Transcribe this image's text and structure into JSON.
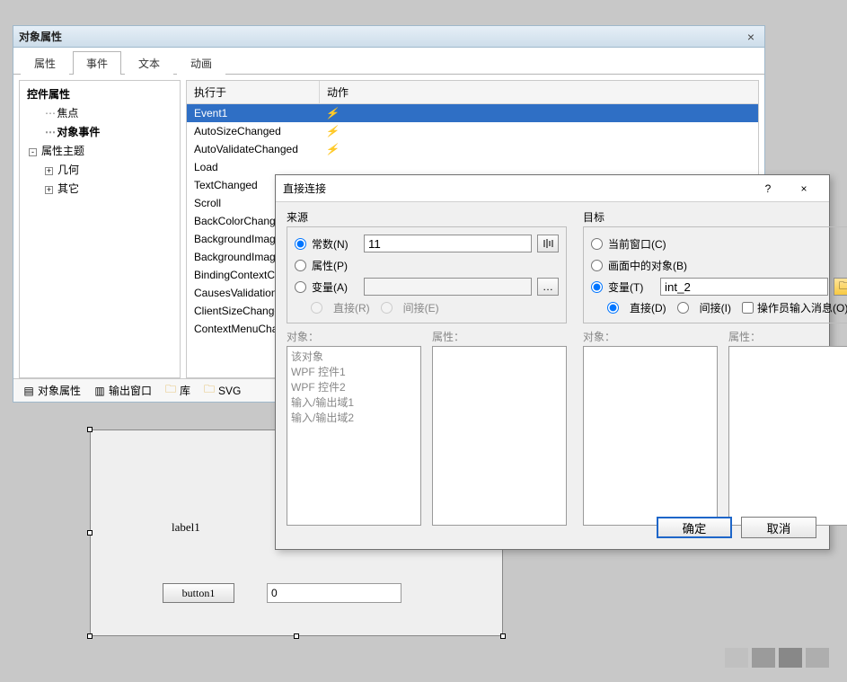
{
  "propWin": {
    "title": "对象属性",
    "tabs": [
      "属性",
      "事件",
      "文本",
      "动画"
    ],
    "activeTab": 1,
    "tree": {
      "header": "控件属性",
      "items": [
        {
          "label": "焦点",
          "indent": 1
        },
        {
          "label": "对象事件",
          "indent": 1,
          "sel": true
        },
        {
          "label": "属性主题",
          "indent": 0,
          "exp": "-"
        },
        {
          "label": "几何",
          "indent": 1,
          "exp": "+"
        },
        {
          "label": "其它",
          "indent": 1,
          "exp": "+"
        }
      ]
    },
    "grid": {
      "col1": "执行于",
      "col2": "动作",
      "rows": [
        {
          "c1": "Event1",
          "sel": true,
          "bolt": true
        },
        {
          "c1": "AutoSizeChanged",
          "bolt": true
        },
        {
          "c1": "AutoValidateChanged",
          "bolt": true
        },
        {
          "c1": "Load"
        },
        {
          "c1": "TextChanged"
        },
        {
          "c1": "Scroll"
        },
        {
          "c1": "BackColorChanged"
        },
        {
          "c1": "BackgroundImageChanged"
        },
        {
          "c1": "BackgroundImageLayoutChanged"
        },
        {
          "c1": "BindingContextChanged"
        },
        {
          "c1": "CausesValidationChanged"
        },
        {
          "c1": "ClientSizeChanged"
        },
        {
          "c1": "ContextMenuChanged"
        }
      ]
    },
    "bottomBar": {
      "objProp": "对象属性",
      "outWin": "输出窗口",
      "lib": "库",
      "svg": "SVG"
    }
  },
  "designer": {
    "label1": "label1",
    "button1": "button1",
    "text0": "0"
  },
  "dialog": {
    "title": "直接连接",
    "help": "?",
    "close": "×",
    "source": {
      "title": "来源",
      "const": "常数(N)",
      "constVal": "11",
      "prop": "属性(P)",
      "var": "变量(A)",
      "direct": "直接(R)",
      "indirect": "间接(E)",
      "objLabel": "对象：",
      "propLabel": "属性：",
      "objects": [
        "该对象",
        "WPF 控件1",
        "WPF 控件2",
        "输入/输出域1",
        "输入/输出域2"
      ]
    },
    "target": {
      "title": "目标",
      "curWin": "当前窗口(C)",
      "objInScreen": "画面中的对象(B)",
      "var": "变量(T)",
      "varVal": "int_2",
      "direct": "直接(D)",
      "indirect": "间接(I)",
      "operatorInput": "操作员输入消息(O)",
      "objLabel": "对象：",
      "propLabel": "属性："
    },
    "ok": "确定",
    "cancel": "取消"
  }
}
